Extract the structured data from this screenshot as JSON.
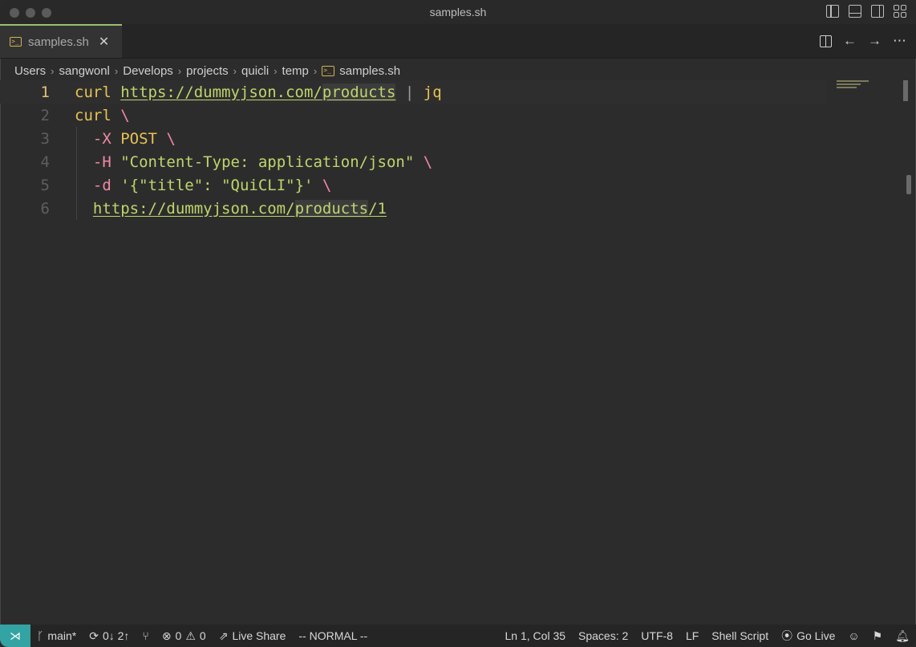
{
  "window": {
    "title": "samples.sh"
  },
  "tab": {
    "label": "samples.sh",
    "close": "✕"
  },
  "breadcrumb": [
    "Users",
    "sangwonl",
    "Develops",
    "projects",
    "quicli",
    "temp",
    "samples.sh"
  ],
  "editor": {
    "lines": [
      {
        "num": "1"
      },
      {
        "num": "2"
      },
      {
        "num": "3"
      },
      {
        "num": "4"
      },
      {
        "num": "5"
      },
      {
        "num": "6"
      }
    ],
    "tokens": {
      "l1_cmd": "curl",
      "l1_url_a": "https://dummyjson.com/",
      "l1_url_b": "products",
      "l1_pipe": "|",
      "l1_jq": "jq",
      "l2_cmd": "curl",
      "l2_bs": "\\",
      "l3_flag": "-X",
      "l3_word": "POST",
      "l3_bs": "\\",
      "l4_flag": "-H",
      "l4_str": "\"Content-Type: application/json\"",
      "l4_bs": "\\",
      "l5_flag": "-d",
      "l5_str": "'{\"title\": \"QuiCLI\"}'",
      "l5_bs": "\\",
      "l6_url_a": "https://dummyjson.com/",
      "l6_url_b": "products",
      "l6_url_c": "/1"
    }
  },
  "statusbar": {
    "branch": "main*",
    "sync": "0↓ 2↑",
    "errors": "0",
    "warnings": "0",
    "live_share": "Live Share",
    "mode": "-- NORMAL --",
    "position": "Ln 1, Col 35",
    "spaces": "Spaces: 2",
    "encoding": "UTF-8",
    "eol": "LF",
    "language": "Shell Script",
    "go_live": "Go Live"
  },
  "colors": {
    "accent_remote": "#33a3a3",
    "tab_border": "#97c26f",
    "keyword": "#e5c353",
    "string": "#bdd66b",
    "flag": "#ef8aa4"
  }
}
